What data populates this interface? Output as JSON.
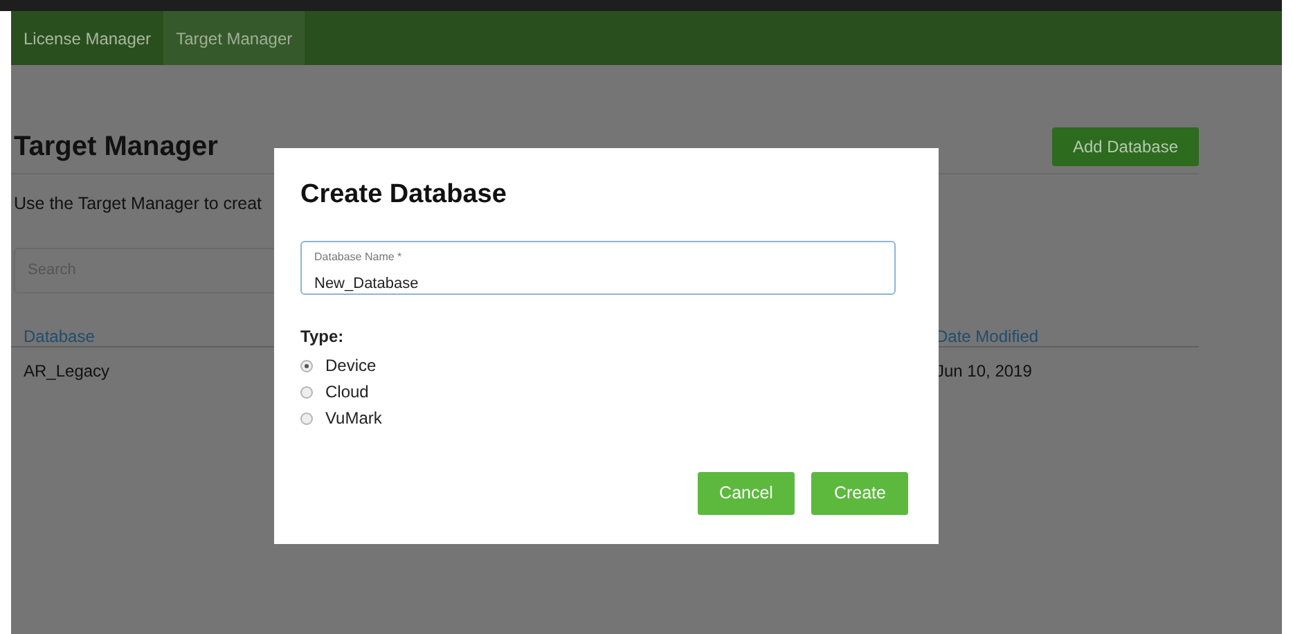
{
  "nav": {
    "tabs": [
      {
        "label": "License Manager",
        "selected": false
      },
      {
        "label": "Target Manager",
        "selected": true
      }
    ]
  },
  "page": {
    "title": "Target Manager",
    "add_button": "Add Database",
    "intro": "Use the Target Manager to creat",
    "search": {
      "placeholder": "Search"
    },
    "table": {
      "columns": [
        "Database",
        "Date Modified"
      ],
      "rows": [
        [
          "AR_Legacy",
          "Jun 10, 2019"
        ]
      ]
    }
  },
  "dialog": {
    "title": "Create Database",
    "field": {
      "label": "Database Name *",
      "value": "New_Database"
    },
    "type_label": "Type:",
    "options": [
      {
        "label": "Device",
        "selected": true
      },
      {
        "label": "Cloud",
        "selected": false
      },
      {
        "label": "VuMark",
        "selected": false
      }
    ],
    "buttons": [
      "Cancel",
      "Create"
    ]
  }
}
